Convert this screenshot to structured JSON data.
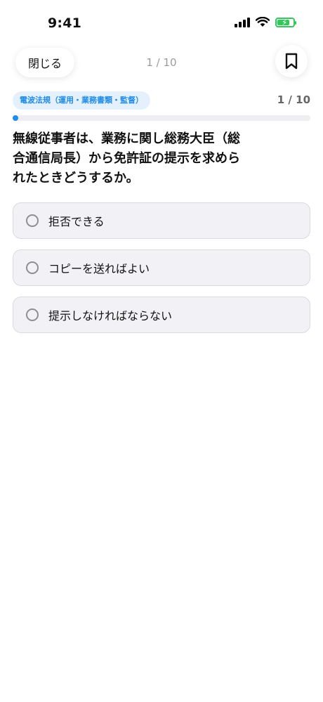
{
  "status_bar": {
    "time": "9:41",
    "icons": [
      "cellular-signal-icon",
      "wifi-icon",
      "battery-charging-icon"
    ],
    "battery_color": "#34c759"
  },
  "nav": {
    "close_label": "閉じる",
    "counter": "1 / 10",
    "bookmark_icon": "bookmark-icon"
  },
  "quiz": {
    "category": "電波法規（運用・業務書類・監督）",
    "count": "1 / 10",
    "progress": 0.02,
    "accent_color": "#1f8bea",
    "question": "無線従事者は、業務に関し総務大臣（総合通信局長）から免許証の提示を求められたときどうするか。",
    "options": [
      {
        "label": "拒否できる"
      },
      {
        "label": "コピーを送ればよい"
      },
      {
        "label": "提示しなければならない"
      }
    ]
  }
}
